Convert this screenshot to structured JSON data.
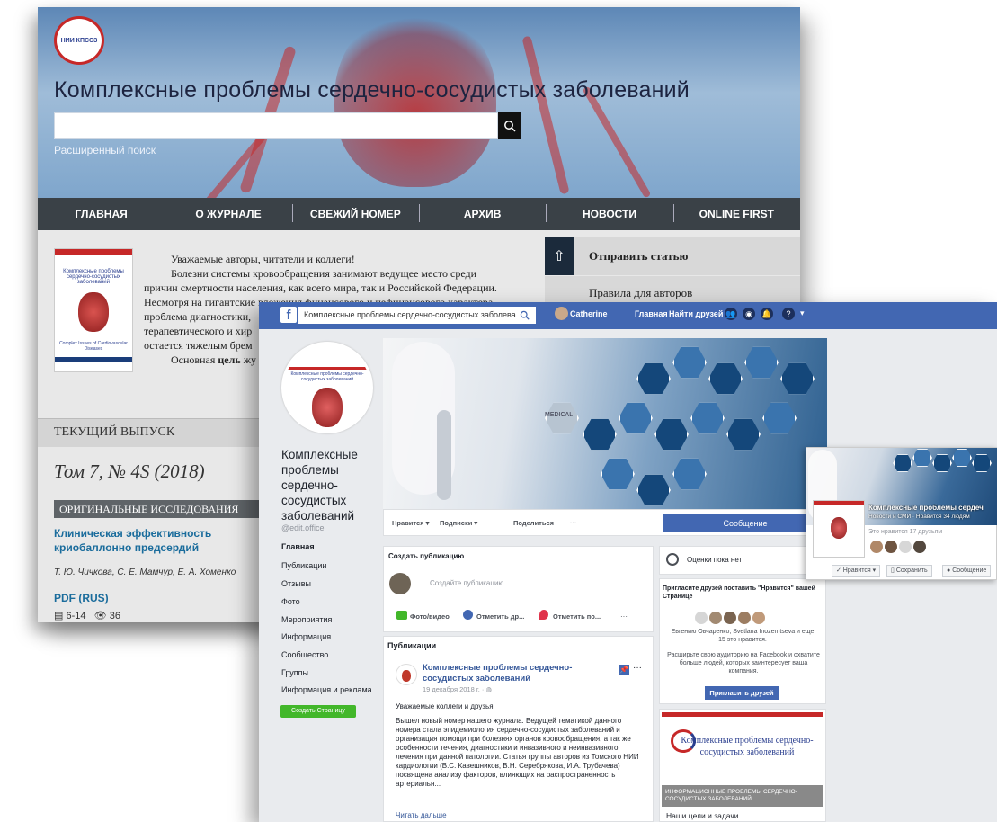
{
  "journal": {
    "logo_text": "НИИ КПССЗ",
    "title": "Комплексные проблемы сердечно-сосудистых заболеваний",
    "search_placeholder": "",
    "advanced_search": "Расширенный поиск",
    "nav": [
      "ГЛАВНАЯ",
      "О ЖУРНАЛЕ",
      "СВЕЖИЙ НОМЕР",
      "АРХИВ",
      "НОВОСТИ",
      "ONLINE FIRST"
    ],
    "cover": {
      "title": "Комплексные проблемы сердечно-сосудистых заболеваний",
      "footer": "Complex Issues of Cardiovascular Diseases"
    },
    "intro": {
      "greeting": "Уважаемые авторы, читатели и коллеги!",
      "paragraph": "Болезни системы кровообращения занимают ведущее место среди причин смертности населения, как всего мира, так и Российской Федерации. Несмотря на гигантские вложения финансового и нефинансового характера проблема диагностики,",
      "line4": "терапевтического и хир",
      "line5": "остается тяжелым брем",
      "line6_prefix": "Основная",
      "line6_bold": "цель",
      "line6_suffix": "жу"
    },
    "sidebar": {
      "submit": "Отправить статью",
      "rules": "Правила для авторов"
    },
    "current_issue": "ТЕКУЩИЙ ВЫПУСК",
    "volume": "Том 7, № 4S (2018)",
    "section": "ОРИГИНАЛЬНЫЕ ИССЛЕДОВАНИЯ",
    "article": {
      "title": "Клиническая эффективность криобаллонно предсердий",
      "authors": "Т. Ю. Чичкова, С. Е. Мамчур, Е. А. Хоменко",
      "pdf": "PDF (RUS)",
      "pages": "6-14",
      "views": "36"
    }
  },
  "facebook": {
    "search_value": "Комплексные проблемы сердечно-сосудистых заболева ...",
    "user": "Catherine",
    "home": "Главная",
    "find_friends": "Найти друзей",
    "page": {
      "name": "Комплексные проблемы сердечно-сосудистых заболеваний",
      "handle": "@edit.office",
      "nav": [
        "Главная",
        "Публикации",
        "Отзывы",
        "Фото",
        "Мероприятия",
        "Информация",
        "Сообщество",
        "Группы",
        "Информация и реклама"
      ],
      "create_page": "Создать Страницу",
      "cover_label": "MEDICAL"
    },
    "actions": {
      "like": "Нравится ▾",
      "follow": "Подписки ▾",
      "share": "Поделиться",
      "more": "···",
      "message": "Сообщение"
    },
    "composer": {
      "title": "Создать публикацию",
      "placeholder": "Создайте публикацию...",
      "photo": "Фото/видео",
      "tag": "Отметить др...",
      "checkin": "Отметить по...",
      "more": "···"
    },
    "posts": {
      "header": "Публикации",
      "author": "Комплексные проблемы сердечно-сосудистых заболеваний",
      "date": "19 декабря 2018 г. · ",
      "greeting": "Уважаемые коллеги и друзья!",
      "body": "Вышел новый номер нашего журнала. Ведущей тематикой данного номера стала эпидемиология сердечно-сосудистых заболеваний и организация помощи при болезнях органов кровообращения, а так же особенности течения, диагностики и инвазивного и неинвазивного лечения при данной патологии. Статья группы авторов из Томского НИИ кардиологии (В.С. Кавешников, В.Н. Серебрякова, И.А. Трубачева) посвящена анализу факторов, влияющих на распространенность артериальн...",
      "read_more": "Читать дальше"
    },
    "rating": "Оценки пока нет",
    "invite": {
      "title": "Пригласите друзей поставить \"Нравится\" вашей Странице",
      "friends": "Евгению Овчаренко, Svetlana Inozemtseva и еще 15 это нравится.",
      "promo": "Расширьте свою аудиторию на Facebook и охватите больше людей, которых заинтересует ваша компания.",
      "button": "Пригласить друзей"
    },
    "promo_card": {
      "logo_text": "Комплексные проблемы сердечно-сосудистых заболеваний",
      "overlay": "ИНФОРМАЦИОННЫЕ ПРОБЛЕМЫ СЕРДЕЧНО-СОСУДИСТЫХ ЗАБОЛЕВАНИЙ",
      "caption": "Наши цели и задачи"
    },
    "mini_card": {
      "name": "Комплексные проблемы сердеч",
      "subtitle": "Новости и СМИ · Нравится 34 людям",
      "liked": "Это нравится 17 друзьям",
      "like": "✓ Нравится ▾",
      "save": "Сохранить",
      "message": "Сообщение"
    }
  }
}
